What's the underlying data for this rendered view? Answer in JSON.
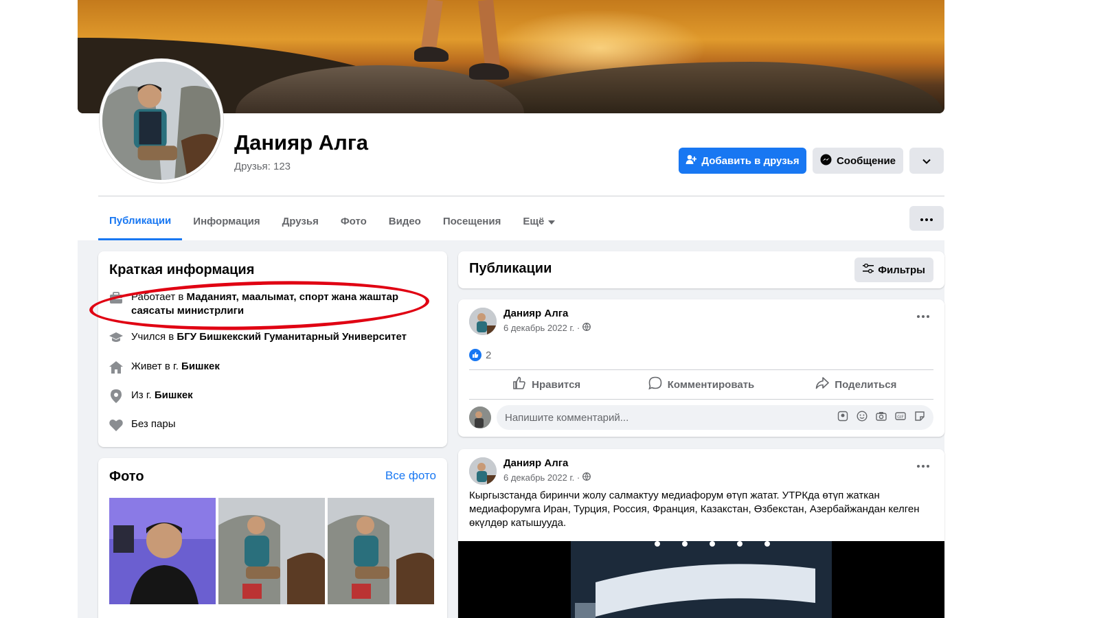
{
  "profile": {
    "name": "Данияр Алга",
    "friends": "Друзья: 123",
    "add_friend_label": "Добавить в друзья",
    "message_label": "Сообщение"
  },
  "tabs": [
    {
      "label": "Публикации",
      "active": true
    },
    {
      "label": "Информация"
    },
    {
      "label": "Друзья"
    },
    {
      "label": "Фото"
    },
    {
      "label": "Видео"
    },
    {
      "label": "Посещения"
    },
    {
      "label": "Ещё"
    }
  ],
  "intro": {
    "title": "Краткая информация",
    "items": [
      {
        "icon": "briefcase-icon",
        "prefix": "Работает в ",
        "value": "Маданият, маалымат, спорт жана жаштар саясаты министрлиги"
      },
      {
        "icon": "graduation-cap-icon",
        "prefix": "Учился в ",
        "value": "БГУ Бишкекский Гуманитарный Университет"
      },
      {
        "icon": "home-icon",
        "prefix": "Живет в г. ",
        "value": "Бишкек"
      },
      {
        "icon": "location-pin-icon",
        "prefix": "Из г. ",
        "value": "Бишкек"
      },
      {
        "icon": "heart-icon",
        "prefix": "Без пары",
        "value": ""
      }
    ]
  },
  "photos": {
    "title": "Фото",
    "all_photos_label": "Все фото"
  },
  "publications": {
    "title": "Публикации",
    "filters_label": "Фильтры"
  },
  "posts": [
    {
      "author": "Данияр Алга",
      "date": "6 декабрь 2022 г. ·",
      "likes": "2",
      "like_label": "Нравится",
      "comment_label": "Комментировать",
      "share_label": "Поделиться",
      "comment_placeholder": "Напишите комментарий..."
    },
    {
      "author": "Данияр Алга",
      "date": "6 декабрь 2022 г. ·",
      "text": "Кыргызстанда биринчи жолу салмактуу медиафорум өтүп жатат. УТРКда өтүп жаткан медиафорумга Иран, Турция, Россия, Франция, Казакстан, Өзбекстан, Азербайжандан келген өкүлдөр катышууда."
    }
  ],
  "colors": {
    "accent": "#1877f2",
    "highlight_annotation": "#e00012",
    "background": "#f0f2f5"
  }
}
